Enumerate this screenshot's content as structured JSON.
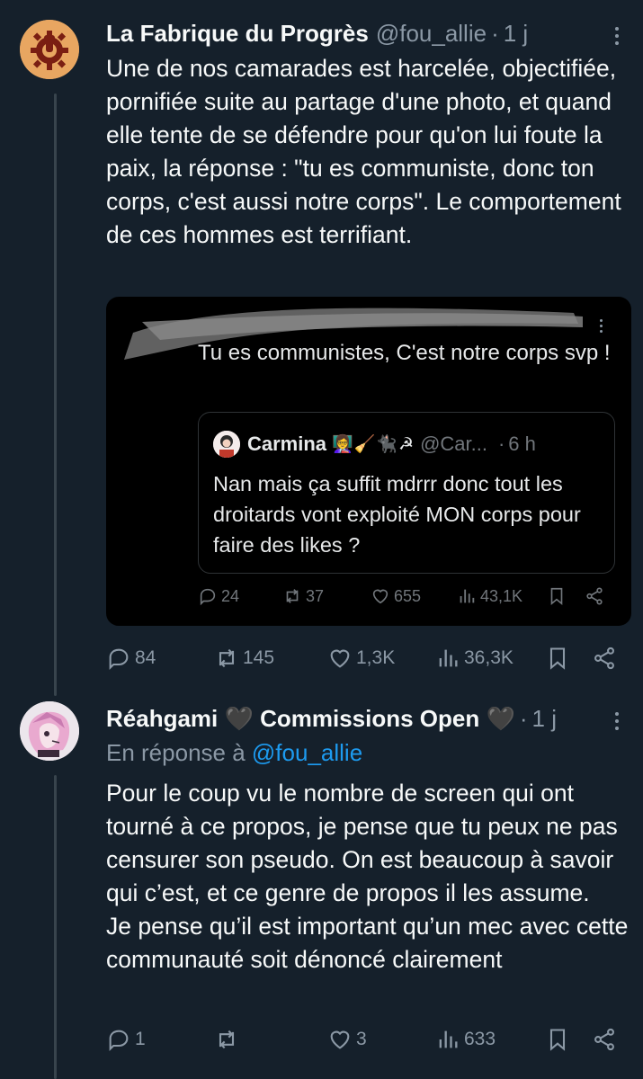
{
  "post1": {
    "author_name": "La Fabrique du Progrès",
    "handle": "@fou_allie",
    "separator": "·",
    "time": "1 j",
    "avatar_icon": "gear-fist-logo",
    "text": "Une de nos camarades est harcelée, objectifiée, pornifiée suite au partage d'une photo, et quand elle tente de se défendre pour qu'on lui foute la paix, la réponse : \"tu es communiste, donc ton corps, c'est aussi notre corps\". Le comportement de ces hommes est terrifiant.",
    "screenshot": {
      "reply_text": "Tu es communistes, C'est notre corps svp !",
      "quoted": {
        "name": "Carmina",
        "emoji": "👩‍🏫🧹🐈‍⬛☭",
        "handle": "@Car...",
        "separator": "·",
        "time": "6 h",
        "text": "Nan mais ça suffit mdrrr donc tout les droitards vont exploité MON corps pour faire des likes ?"
      },
      "stats": {
        "replies": "24",
        "reposts": "37",
        "likes": "655",
        "views": "43,1K"
      }
    },
    "stats": {
      "replies": "84",
      "reposts": "145",
      "likes": "1,3K",
      "views": "36,3K"
    }
  },
  "post2": {
    "author_name": "Réahgami 🖤 Commissions Open 🖤",
    "separator": "·",
    "time": "1 j",
    "reply_to_prefix": "En réponse à",
    "reply_to_handle": "@fou_allie",
    "text_line1": "Pour le coup vu le nombre de screen qui ont tourné à ce propos, je pense que tu peux ne pas censurer son pseudo. On est beaucoup à savoir qui c’est, et ce genre de propos il les assume.",
    "text_line2": "Je pense qu’il est important qu’un mec avec cette communauté soit dénoncé clairement",
    "stats": {
      "replies": "1",
      "reposts": "",
      "likes": "3",
      "views": "633"
    }
  },
  "colors": {
    "background": "#15202b",
    "text": "#f7f9f9",
    "muted": "#8b98a5",
    "link": "#1d9bf0",
    "logo_orange": "#e8a661",
    "logo_dark_red": "#7a1e12"
  }
}
